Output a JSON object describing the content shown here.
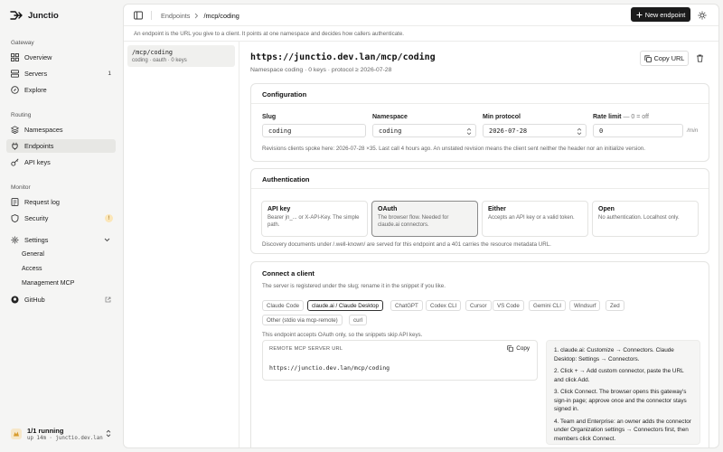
{
  "app": {
    "name": "Junctio"
  },
  "sidebar": {
    "sections": [
      {
        "label": "Gateway",
        "items": [
          {
            "label": "Overview",
            "icon": "grid-icon"
          },
          {
            "label": "Servers",
            "icon": "server-icon",
            "count": "1"
          },
          {
            "label": "Explore",
            "icon": "compass-icon"
          }
        ]
      },
      {
        "label": "Routing",
        "items": [
          {
            "label": "Namespaces",
            "icon": "layers-icon"
          },
          {
            "label": "Endpoints",
            "icon": "plug-icon",
            "active": true
          },
          {
            "label": "API keys",
            "icon": "key-icon"
          }
        ]
      },
      {
        "label": "Monitor",
        "items": [
          {
            "label": "Request log",
            "icon": "list-icon"
          },
          {
            "label": "Security",
            "icon": "shield-icon",
            "badge": "!"
          }
        ]
      }
    ],
    "settings": {
      "label": "Settings",
      "children": [
        "General",
        "Access",
        "Management MCP"
      ]
    },
    "github": {
      "label": "GitHub"
    },
    "footer": {
      "title": "1/1 running",
      "subtitle": "up 14m · junctio.dev.lan"
    }
  },
  "topbar": {
    "breadcrumb": [
      "Endpoints",
      "/mcp/coding"
    ],
    "new_button": "New endpoint"
  },
  "subheader": "An endpoint is the URL you give to a client. It points at one namespace and decides how callers authenticate.",
  "endpoints_list": [
    {
      "path": "/mcp/coding",
      "meta": "coding · oauth · 0 keys"
    }
  ],
  "endpoint": {
    "url": "https://junctio.dev.lan/mcp/coding",
    "meta": "Namespace coding · 0 keys · protocol ≥ 2026-07-28",
    "copy_url": "Copy URL"
  },
  "configuration": {
    "title": "Configuration",
    "slug": {
      "label": "Slug",
      "value": "coding"
    },
    "namespace": {
      "label": "Namespace",
      "value": "coding"
    },
    "min_protocol": {
      "label": "Min protocol",
      "value": "2026-07-28"
    },
    "rate_limit": {
      "label": "Rate limit",
      "hint": "— 0 = off",
      "value": "0",
      "unit": "/min"
    },
    "note": "Revisions clients spoke here: 2026-07-28 ×35. Last call 4 hours ago. An unstated revision means the client sent neither the header nor an initialize version."
  },
  "authentication": {
    "title": "Authentication",
    "options": [
      {
        "title": "API key",
        "desc": "Bearer jn_... or X-API-Key. The simple path."
      },
      {
        "title": "OAuth",
        "desc": "The browser flow. Needed for claude.ai connectors.",
        "selected": true
      },
      {
        "title": "Either",
        "desc": "Accepts an API key or a valid token."
      },
      {
        "title": "Open",
        "desc": "No authentication. Localhost only."
      }
    ],
    "note": "Discovery documents under /.well-known/ are served for this endpoint and a 401 carries the resource metadata URL."
  },
  "connect": {
    "title": "Connect a client",
    "subtitle": "The server is registered under the slug; rename it in the snippet if you like.",
    "clients": [
      "Claude Code",
      "claude.ai / Claude Desktop",
      "ChatGPT",
      "Codex CLI",
      "Cursor",
      "VS Code",
      "Gemini CLI",
      "Windsurf",
      "Zed",
      "Other (stdio via mcp-remote)",
      "curl"
    ],
    "selected_client": "claude.ai / Claude Desktop",
    "note": "This endpoint accepts OAuth only, so the snippets skip API keys.",
    "snippet": {
      "label": "REMOTE MCP SERVER URL",
      "copy": "Copy",
      "value": "https://junctio.dev.lan/mcp/coding"
    },
    "steps": [
      "claude.ai: Customize → Connectors. Claude Desktop: Settings → Connectors.",
      "Click + → Add custom connector, paste the URL and click Add.",
      "Click Connect. The browser opens this gateway's sign-in page; approve once and the connector stays signed in.",
      "Team and Enterprise: an owner adds the connector under Organization settings → Connectors first, then members click Connect."
    ]
  }
}
